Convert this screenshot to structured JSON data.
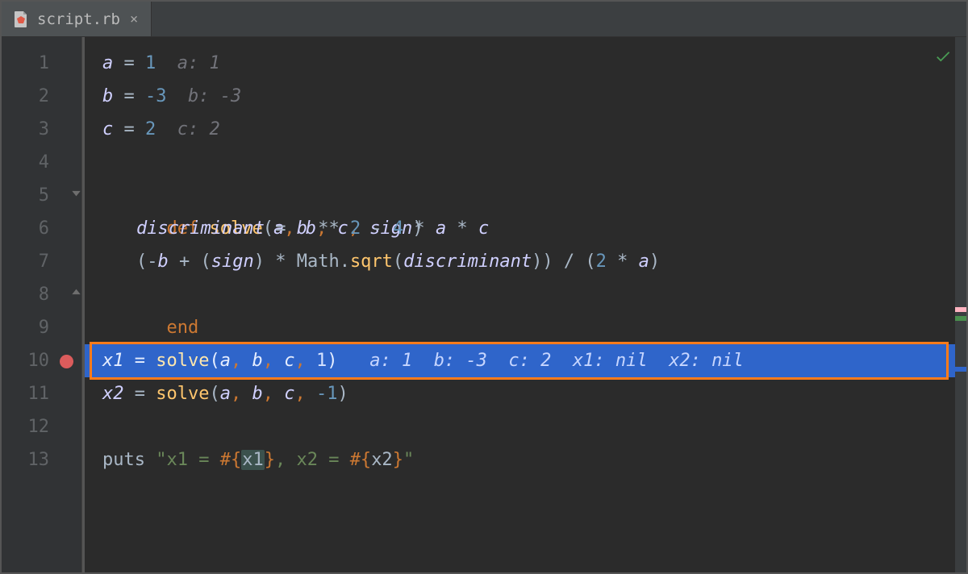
{
  "tab": {
    "filename": "script.rb",
    "close_glyph": "×"
  },
  "line_numbers": [
    "1",
    "2",
    "3",
    "4",
    "5",
    "6",
    "7",
    "8",
    "9",
    "10",
    "11",
    "12",
    "13"
  ],
  "breakpoint_line": 10,
  "highlight_line": 10,
  "code": {
    "l1": {
      "var": "a",
      "eq": " = ",
      "val": "1",
      "hint": "  a: 1"
    },
    "l2": {
      "var": "b",
      "eq": " = ",
      "val": "-3",
      "hint": "  b: -3"
    },
    "l3": {
      "var": "c",
      "eq": " = ",
      "val": "2",
      "hint": "  c: 2"
    },
    "l5": {
      "def": "def ",
      "name": "solve",
      "op": "(",
      "a": "a",
      "c1": ", ",
      "b": "b",
      "c2": ", ",
      "c": "c",
      "c3": ", ",
      "s": "sign",
      "cp": ")"
    },
    "l6": {
      "var": "discriminant",
      "eq": " = ",
      "b": "b",
      "pow": " ** ",
      "two": "2",
      "m1": " - ",
      "four": "4",
      "m2": " * ",
      "a": "a",
      "m3": " * ",
      "c": "c"
    },
    "l7": {
      "op1": "(-",
      "b": "b",
      "op2": " + (",
      "s": "sign",
      "op3": ") * ",
      "math": "Math",
      "dot": ".",
      "sqrt": "sqrt",
      "op4": "(",
      "d": "discriminant",
      "op5": ")) / (",
      "two": "2",
      "op6": " * ",
      "a": "a",
      "op7": ")"
    },
    "l8": {
      "end": "end"
    },
    "l10": {
      "var": "x1",
      "eq": " = ",
      "name": "solve",
      "op": "(",
      "a": "a",
      "c1": ", ",
      "b": "b",
      "c2": ", ",
      "c": "c",
      "c3": ", ",
      "one": "1",
      "cp": ")",
      "hint": "   a: 1  b: -3  c: 2  x1: nil  x2: nil"
    },
    "l11": {
      "var": "x2",
      "eq": " = ",
      "name": "solve",
      "op": "(",
      "a": "a",
      "c1": ", ",
      "b": "b",
      "c2": ", ",
      "c": "c",
      "c3": ", ",
      "one": "-1",
      "cp": ")"
    },
    "l13": {
      "puts": "puts ",
      "s1": "\"x1 = ",
      "i1o": "#{",
      "i1": "x1",
      "i1c": "}",
      "s2": ", x2 = ",
      "i2o": "#{",
      "i2": "x2",
      "i2c": "}",
      "s3": "\""
    }
  }
}
